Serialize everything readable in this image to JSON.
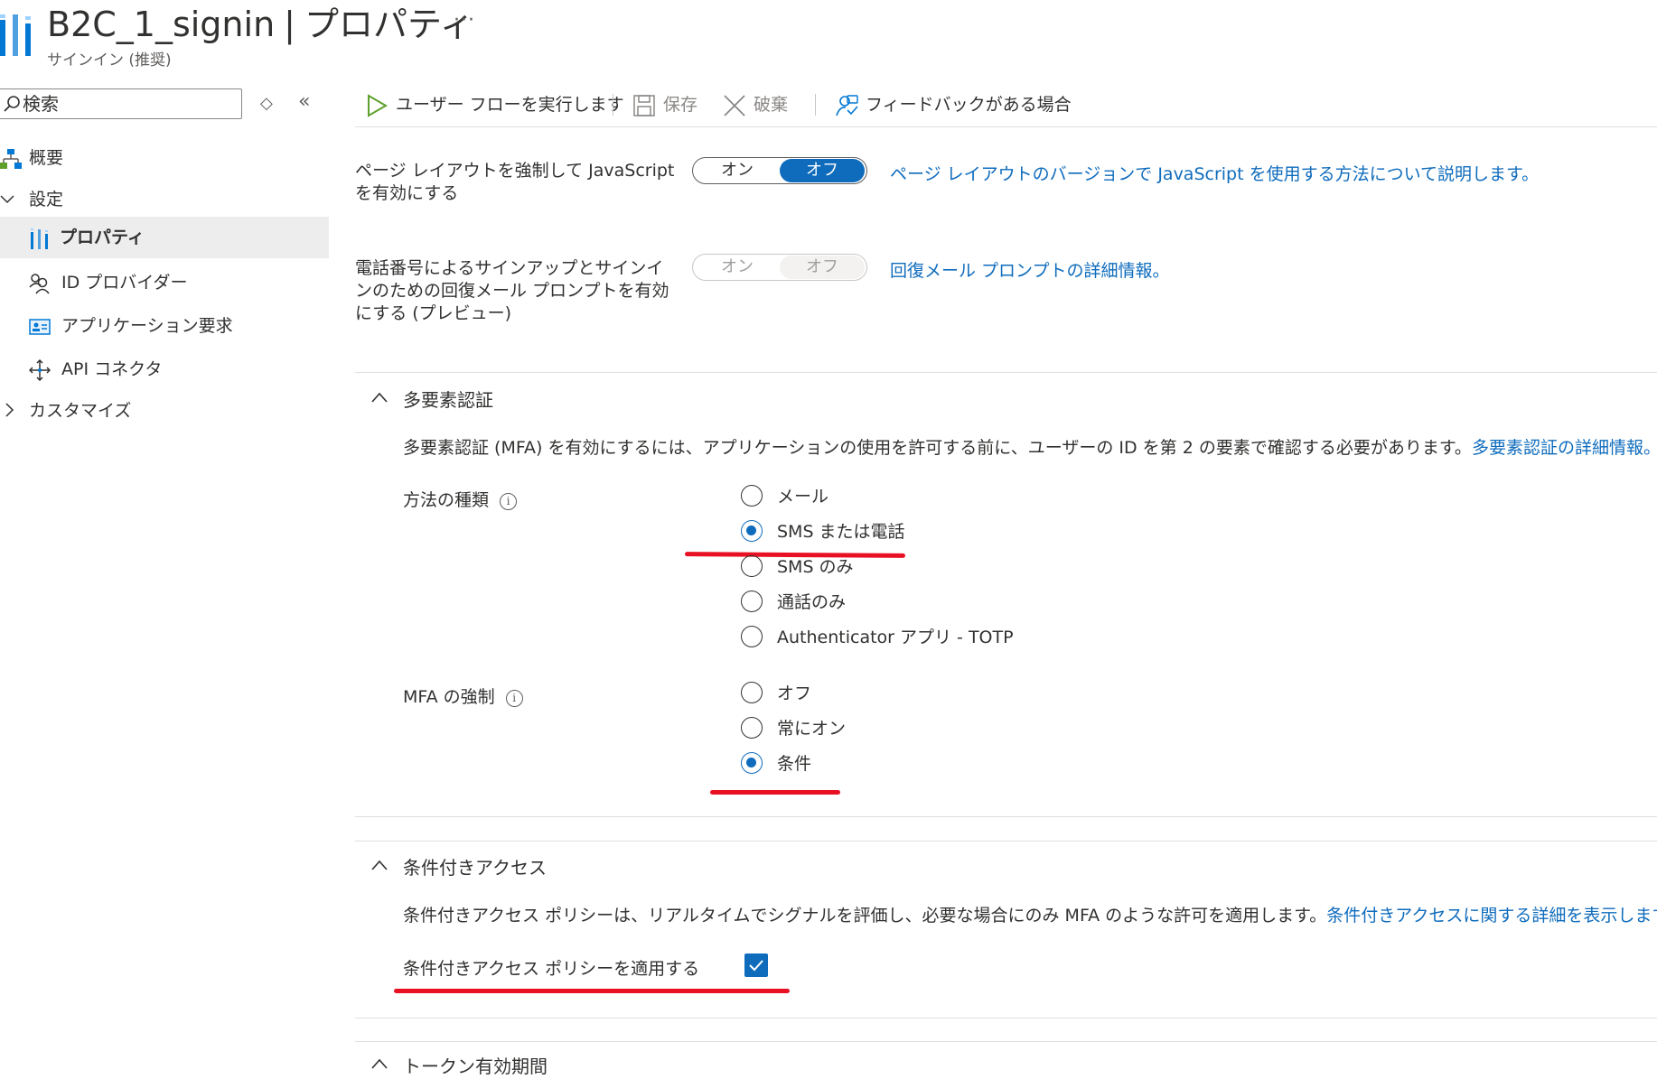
{
  "header": {
    "name": "B2C_1_signin",
    "separator": "|",
    "page": "プロパティ",
    "more": "···",
    "subtitle": "サインイン (推奨)"
  },
  "sidebar": {
    "search_placeholder": "検索",
    "items": [
      {
        "label": "概要",
        "icon": "sitemap-icon"
      },
      {
        "label": "設定",
        "icon": "chevron-down-icon"
      },
      {
        "label": "プロパティ",
        "icon": "properties-icon",
        "active": true
      },
      {
        "label": "ID プロバイダー",
        "icon": "identity-provider-icon"
      },
      {
        "label": "アプリケーション要求",
        "icon": "app-claims-icon"
      },
      {
        "label": "API コネクタ",
        "icon": "api-connector-icon"
      },
      {
        "label": "カスタマイズ",
        "icon": "chevron-right-icon"
      }
    ]
  },
  "toolbar": {
    "run": "ユーザー フローを実行します",
    "save": "保存",
    "discard": "破棄",
    "feedback": "フィードバックがある場合"
  },
  "settings": {
    "js": {
      "label": "ページ レイアウトを強制して JavaScript を有効にする",
      "on": "オン",
      "off": "オフ",
      "value": "オフ",
      "link": "ページ レイアウトのバージョンで JavaScript を使用する方法について説明します。"
    },
    "phone": {
      "label": "電話番号によるサインアップとサインインのための回復メール プロンプトを有効にする (プレビュー)",
      "on": "オン",
      "off": "オフ",
      "value": "オフ",
      "disabled": true,
      "link": "回復メール プロンプトの詳細情報。"
    }
  },
  "mfa": {
    "title": "多要素認証",
    "description": "多要素認証 (MFA) を有効にするには、アプリケーションの使用を許可する前に、ユーザーの ID を第 2 の要素で確認する必要があります。",
    "link": "多要素認証の詳細情報。",
    "method_label": "方法の種類",
    "methods": [
      "メール",
      "SMS または電話",
      "SMS のみ",
      "通話のみ",
      "Authenticator アプリ - TOTP"
    ],
    "method_selected": "SMS または電話",
    "enforce_label": "MFA の強制",
    "enforce_options": [
      "オフ",
      "常にオン",
      "条件"
    ],
    "enforce_selected": "条件"
  },
  "conditional_access": {
    "title": "条件付きアクセス",
    "description": "条件付きアクセス ポリシーは、リアルタイムでシグナルを評価し、必要な場合にのみ MFA のような許可を適用します。",
    "link": "条件付きアクセスに関する詳細を表示します。",
    "checkbox_label": "条件付きアクセス ポリシーを適用する",
    "checked": true
  },
  "token": {
    "title": "トークン有効期間"
  },
  "colors": {
    "accent": "#0f6cbd",
    "annotation": "#e81123"
  }
}
